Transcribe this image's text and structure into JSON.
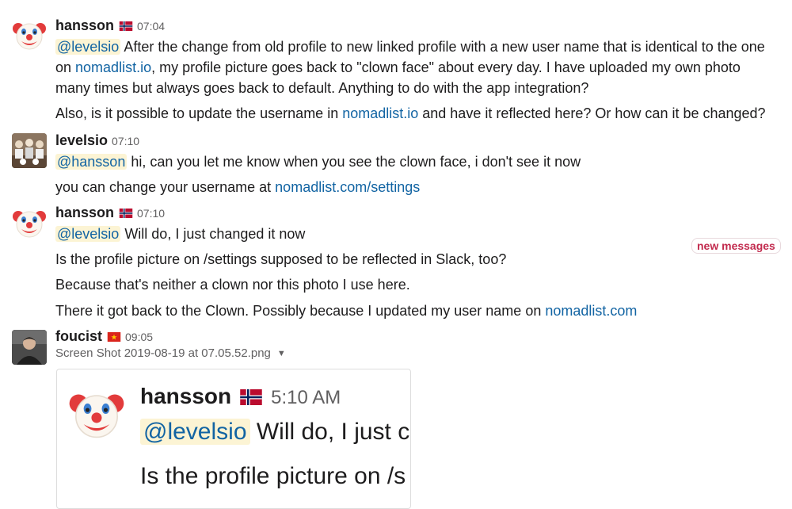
{
  "messages": [
    {
      "user": "hansson",
      "flag": "norway-flag",
      "time": "07:04",
      "line1_mention": "@levelsio",
      "line1_text": " After the change from old profile to new linked profile with a new user name that is identical to the one on ",
      "line1_link": "nomadlist.io",
      "line1_tail": ", my profile picture goes back to \"clown face\" about every day. I have uploaded my own photo many times but always goes back to default. Anything to do with the app integration?",
      "line2_text": "Also, is it possible to update the username in ",
      "line2_link": "nomadlist.io",
      "line2_tail": " and have it reflected here? Or how can it be changed?"
    },
    {
      "user": "levelsio",
      "time": "07:10",
      "line1_mention": "@hansson",
      "line1_text": " hi, can you let me know when you see the clown face, i don't see it now",
      "line2_text": "you can change your username at ",
      "line2_link": "nomadlist.com/settings"
    },
    {
      "user": "hansson",
      "flag": "norway-flag",
      "time": "07:10",
      "line1_mention": "@levelsio",
      "line1_text": " Will do, I just changed it now",
      "line2_text": "Is the profile picture on /settings supposed to be reflected in Slack, too?",
      "line3_text": "Because that's neither a clown nor this photo I use here.",
      "line4_text": "There it got back to the Clown. Possibly because I updated my user name on ",
      "line4_link": "nomadlist.com"
    },
    {
      "user": "foucist",
      "flag": "vietnam-flag",
      "time": "09:05",
      "file_name": "Screen Shot 2019-08-19 at 07.05.52.png",
      "caret_icon": "caret-down-icon"
    }
  ],
  "new_messages_badge": "new messages",
  "screenshot": {
    "user": "hansson",
    "time": "5:10 AM",
    "line1_mention": "@levelsio",
    "line1_text": " Will do, I just c",
    "line2_text": "Is the profile picture on /s"
  },
  "colors": {
    "link": "#1264a3",
    "mention_bg": "#fcf4d4",
    "new_messages": "#c22b4e",
    "timestamp": "#616061"
  }
}
